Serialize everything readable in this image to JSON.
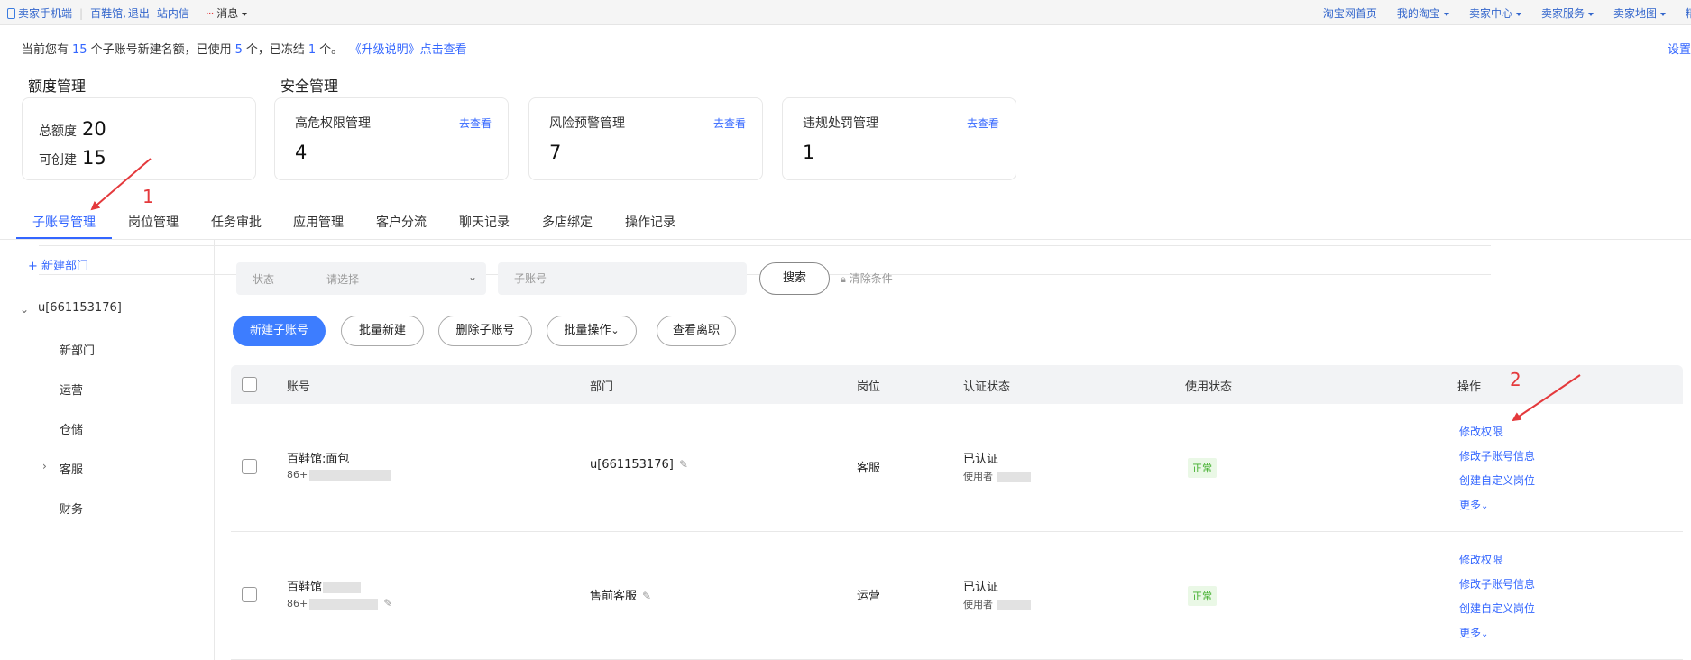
{
  "topbar": {
    "phone": "卖家手机端",
    "user": "百鞋馆",
    "logout": "退出",
    "inbox": "站内信",
    "messages": "消息",
    "right": [
      "淘宝网首页",
      "我的淘宝",
      "卖家中心",
      "卖家服务",
      "卖家地图"
    ],
    "right_tail": "精"
  },
  "notice": {
    "prefix": "当前您有",
    "total": "15",
    "mid1": "个子账号新建名额，已使用",
    "used": "5",
    "mid2": "个，已冻结",
    "frozen": "1",
    "suffix": "个。",
    "link": "《升级说明》点击查看",
    "settings": "设置"
  },
  "quota": {
    "title": "额度管理",
    "total_label": "总额度",
    "total_value": "20",
    "creatable_label": "可创建",
    "creatable_value": "15"
  },
  "security": {
    "title": "安全管理",
    "cards": [
      {
        "title": "高危权限管理",
        "link": "去查看",
        "value": "4"
      },
      {
        "title": "风险预警管理",
        "link": "去查看",
        "value": "7"
      },
      {
        "title": "违规处罚管理",
        "link": "去查看",
        "value": "1"
      }
    ]
  },
  "tabs": [
    "子账号管理",
    "岗位管理",
    "任务审批",
    "应用管理",
    "客户分流",
    "聊天记录",
    "多店绑定",
    "操作记录"
  ],
  "tree": {
    "add": "+ 新建部门",
    "root": "u[661153176]",
    "children": [
      "新部门",
      "运营",
      "仓储",
      "客服",
      "财务"
    ]
  },
  "filters": {
    "status_label": "状态",
    "status_placeholder": "请选择",
    "account_placeholder": "子账号",
    "search": "搜索",
    "clear": "清除条件"
  },
  "actions": [
    "新建子账号",
    "批量新建",
    "删除子账号",
    "批量操作",
    "查看离职"
  ],
  "table": {
    "headers": [
      "账号",
      "部门",
      "岗位",
      "认证状态",
      "使用状态",
      "操作"
    ],
    "rows": [
      {
        "account": "百鞋馆:面包",
        "phone": "86+",
        "dept": "u[661153176]",
        "post": "客服",
        "auth": "已认证",
        "user_prefix": "使用者",
        "status": "正常",
        "ops": [
          "修改权限",
          "修改子账号信息",
          "创建自定义岗位",
          "更多"
        ]
      },
      {
        "account": "百鞋馆",
        "phone": "86+",
        "dept": "售前客服",
        "post": "运营",
        "auth": "已认证",
        "user_prefix": "使用者",
        "status": "正常",
        "ops": [
          "修改权限",
          "修改子账号信息",
          "创建自定义岗位",
          "更多"
        ]
      }
    ]
  },
  "annotations": {
    "one": "1",
    "two": "2"
  },
  "colors": {
    "accent": "#3366ff",
    "primary_button": "#3d7dff",
    "annotation": "#e4393c",
    "ok_badge": "#3fae2a"
  }
}
